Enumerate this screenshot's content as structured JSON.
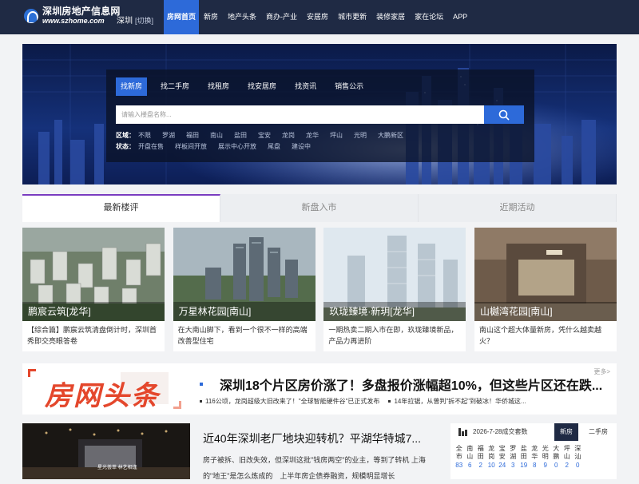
{
  "header": {
    "logo_cn": "深圳房地产信息网",
    "logo_en": "www.szhome.com",
    "city": "深圳",
    "city_switch": "[切换]",
    "nav": [
      "房网首页",
      "新房",
      "地产头条",
      "商办-产业",
      "安居房",
      "城市更新",
      "装修家居",
      "家在论坛",
      "APP"
    ]
  },
  "search": {
    "tabs": [
      "找新房",
      "找二手房",
      "找租房",
      "找安居房",
      "找资讯",
      "销售公示"
    ],
    "placeholder": "请输入楼盘名称...",
    "area_label": "区域：",
    "areas": [
      "不限",
      "罗湖",
      "福田",
      "南山",
      "盐田",
      "宝安",
      "龙岗",
      "龙华",
      "坪山",
      "光明",
      "大鹏新区"
    ],
    "status_label": "状态：",
    "statuses": [
      "开盘在售",
      "样板间开放",
      "展示中心开放",
      "尾盘",
      "建设中"
    ]
  },
  "tabs": [
    "最新楼评",
    "新盘入市",
    "近期活动"
  ],
  "cards": [
    {
      "title": "鹏宸云筑[龙华]",
      "desc": "【综合篇】鹏宸云筑清盘倒计时，深圳首秀即交亮眼答卷"
    },
    {
      "title": "万星林花园[南山]",
      "desc": "在大南山脚下，看到一个很不一样的高端改善型住宅"
    },
    {
      "title": "玖珑臻境·新玥[龙华]",
      "desc": "一期热卖二期入市在即，玖珑臻境新品，产品力再进阶"
    },
    {
      "title": "山樾湾花园[南山]",
      "desc": "南山这个超大体量新房，凭什么越卖越火？"
    }
  ],
  "headline": {
    "logo_text": "房网头条",
    "title": "深圳18个片区房价涨了！多盘报价涨幅超10%，但这些片区还在跌...",
    "more": "更多>",
    "sub": [
      "116公顷，龙岗超级大旧改来了！\"全球智能硬件谷\"已正式发布",
      "14年拉锯，从曾判\"拆不起\"到破冰！华侨城这..."
    ]
  },
  "news": {
    "image_text": "星光荟萃  林艺相逢",
    "title": "近40年深圳老厂地块迎转机？平湖华特城7...",
    "text": "房子被拆、旧改失效，但深圳这批\"钱房两空\"的业主，等到了转机 上海的\"地王\"是怎么炼成的　上半年房企债券融资，规模明显增长"
  },
  "deals": {
    "date": "2026-7-28成交套数",
    "tabs": [
      "新房",
      "二手房"
    ],
    "districts": [
      {
        "name": "全市",
        "count": "83"
      },
      {
        "name": "南山",
        "count": "6"
      },
      {
        "name": "福田",
        "count": "2"
      },
      {
        "name": "龙岗",
        "count": "10"
      },
      {
        "name": "宝安",
        "count": "24"
      },
      {
        "name": "罗湖",
        "count": "3"
      },
      {
        "name": "盐田",
        "count": "19"
      },
      {
        "name": "龙华",
        "count": "8"
      },
      {
        "name": "光明",
        "count": "9"
      },
      {
        "name": "大鹏",
        "count": "0"
      },
      {
        "name": "坪山",
        "count": "2"
      },
      {
        "name": "深汕",
        "count": "0"
      }
    ]
  },
  "colors": {
    "nav_bg": "#1f2a44",
    "accent_blue": "#2d6ad9",
    "headline_red": "#e4472c",
    "tab_purple": "#7a3cc0"
  }
}
